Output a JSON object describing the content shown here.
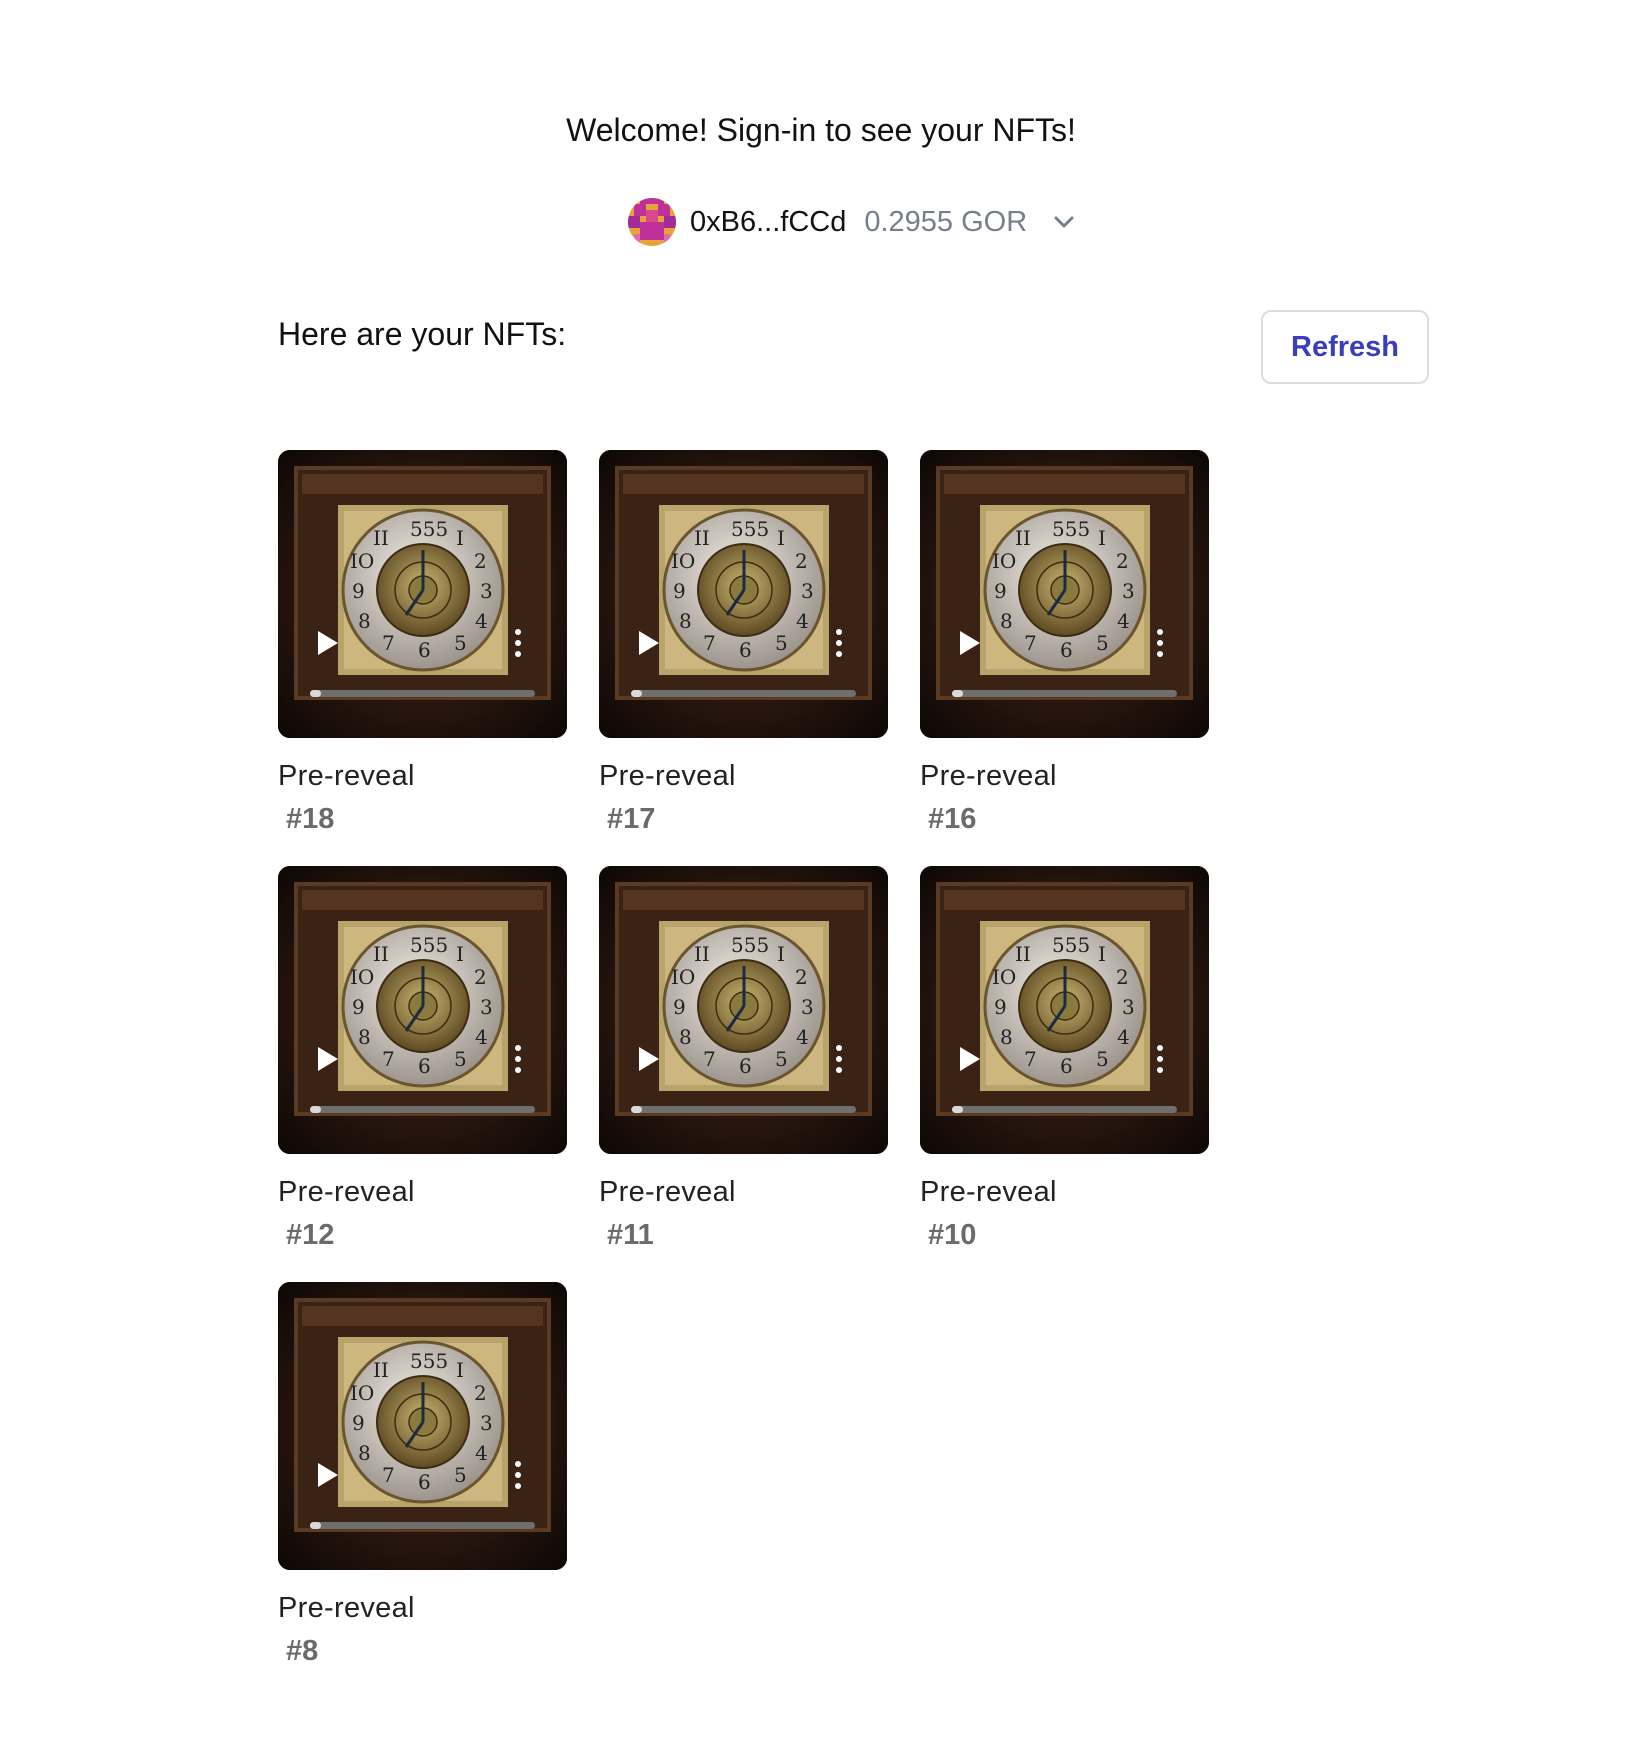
{
  "header": {
    "welcome": "Welcome! Sign-in to see your NFTs!"
  },
  "wallet": {
    "address": "0xB6...fCCd",
    "balance": "0.2955 GOR",
    "avatar_icon": "pixel-avatar-icon",
    "dropdown_icon": "chevron-down-icon"
  },
  "nfts_section": {
    "title": "Here are your NFTs:",
    "refresh_label": "Refresh"
  },
  "colors": {
    "accent": "#3b3dbf",
    "balance_text": "#777e8c",
    "id_text": "#6b6b6b"
  },
  "video_controls": {
    "play_icon": "play-icon",
    "menu_icon": "more-vertical-icon",
    "progress": 0.05
  },
  "nfts": [
    {
      "name": "Pre-reveal",
      "id": "#18"
    },
    {
      "name": "Pre-reveal",
      "id": "#17"
    },
    {
      "name": "Pre-reveal",
      "id": "#16"
    },
    {
      "name": "Pre-reveal",
      "id": "#12"
    },
    {
      "name": "Pre-reveal",
      "id": "#11"
    },
    {
      "name": "Pre-reveal",
      "id": "#10"
    },
    {
      "name": "Pre-reveal",
      "id": "#8"
    }
  ]
}
